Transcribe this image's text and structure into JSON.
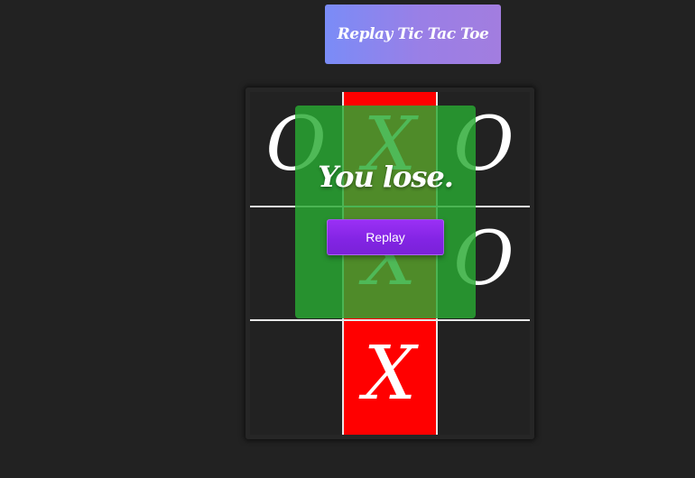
{
  "header": {
    "replay_game_label": "Replay Tic Tac Toe"
  },
  "board": {
    "cells": [
      {
        "mark": "O",
        "winning": false
      },
      {
        "mark": "X",
        "winning": true
      },
      {
        "mark": "O",
        "winning": false
      },
      {
        "mark": "",
        "winning": false
      },
      {
        "mark": "X",
        "winning": true
      },
      {
        "mark": "O",
        "winning": false
      },
      {
        "mark": "",
        "winning": false
      },
      {
        "mark": "X",
        "winning": true
      },
      {
        "mark": "",
        "winning": false
      }
    ]
  },
  "result": {
    "message": "You lose.",
    "replay_label": "Replay"
  },
  "colors": {
    "background": "#222222",
    "win_highlight": "#ff0000",
    "overlay": "#28aa32",
    "replay_button": "#8a2be2",
    "header_gradient_start": "#7a8cf7",
    "header_gradient_end": "#a27ddf"
  }
}
